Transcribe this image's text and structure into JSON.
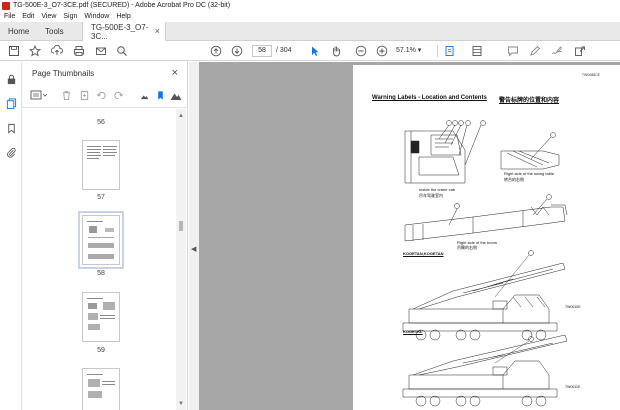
{
  "window": {
    "title": "TG-500E-3_O7-3CE.pdf (SECURED) - Adobe Acrobat Pro DC (32-bit)"
  },
  "menu": [
    "File",
    "Edit",
    "View",
    "Sign",
    "Window",
    "Help"
  ],
  "tabs": {
    "home": "Home",
    "tools": "Tools",
    "document": "TG-500E-3_O7-3C..."
  },
  "toolbar": {
    "current_page": "58",
    "total_pages": "/ 304",
    "zoom": "57.1%"
  },
  "panel": {
    "title": "Page Thumbnails"
  },
  "thumbnails": [
    {
      "label": "56"
    },
    {
      "label": "57"
    },
    {
      "label": "58",
      "selected": true
    },
    {
      "label": "59"
    }
  ],
  "document": {
    "code": "TW0088CE",
    "title": "Warning Labels - Location and Contents",
    "title_cn": "警告标牌的位置和内容",
    "caption_cab": "Inside the crane cab",
    "caption_cab_cn": "吊车驾驶室内",
    "caption_swing": "Right side of the swing table",
    "caption_swing_cn": "转台的右侧",
    "caption_boom": "Right side of the boom",
    "caption_boom_cn": "吊臂的右侧",
    "model_a": "KOGETAN,KOGETAN",
    "model_b": "KOGETKL",
    "ref_a": "TW0010E",
    "ref_b": "TW0011E"
  },
  "colors": {
    "accent": "#1473e6",
    "doc_bg": "#a7a7a7",
    "app_red": "#d2231d"
  },
  "icons": {
    "home": "home-icon",
    "star": "star-icon",
    "upload": "upload-icon",
    "print": "print-icon",
    "mail": "mail-icon",
    "search": "search-icon",
    "prev": "prev-page-icon",
    "next": "next-page-icon",
    "select": "select-cursor-icon",
    "hand": "hand-icon",
    "zoom_out": "zoom-out-icon",
    "zoom_in": "zoom-in-icon"
  }
}
